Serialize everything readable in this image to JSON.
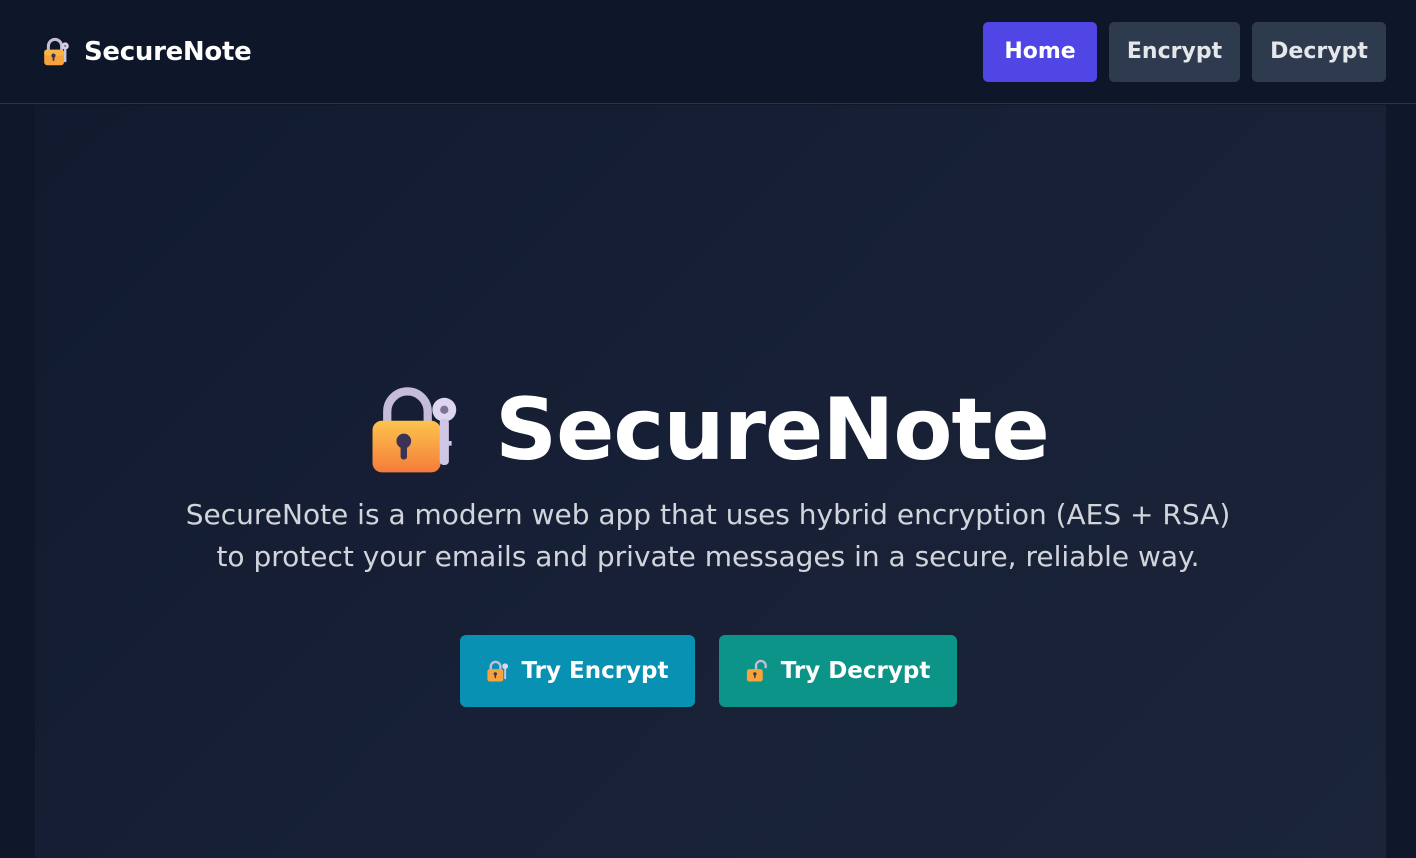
{
  "brand": {
    "name": "SecureNote",
    "icon": "lock-with-key-icon"
  },
  "nav": {
    "items": [
      {
        "label": "Home",
        "active": true
      },
      {
        "label": "Encrypt",
        "active": false
      },
      {
        "label": "Decrypt",
        "active": false
      }
    ]
  },
  "hero": {
    "title": "SecureNote",
    "icon": "lock-with-key-icon",
    "description_line1": "SecureNote is a modern web app that uses hybrid encryption (AES + RSA)",
    "description_line2": "to protect your emails and private messages in a secure, reliable way."
  },
  "cta": {
    "encrypt": {
      "label": "Try Encrypt",
      "icon": "lock-with-key-icon",
      "color": "#0891b2"
    },
    "decrypt": {
      "label": "Try Decrypt",
      "icon": "unlocked-padlock-icon",
      "color": "#0d9488"
    }
  },
  "colors": {
    "background": "#0f172a",
    "accent": "#4f46e5",
    "nav_button": "#2e3b4e"
  }
}
